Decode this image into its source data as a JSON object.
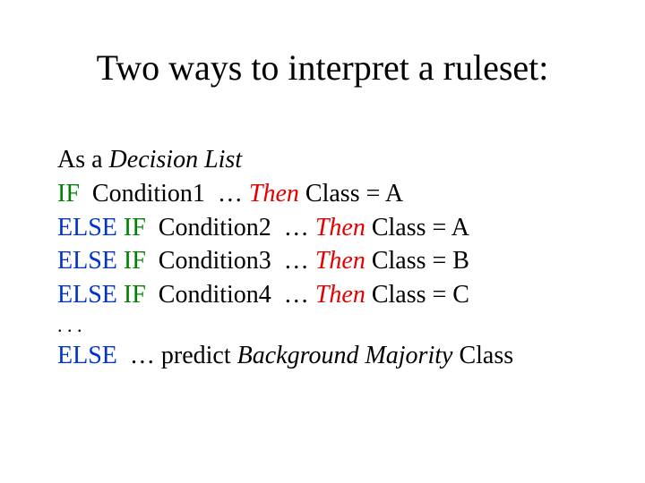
{
  "title": "Two ways to interpret a ruleset:",
  "lines": {
    "l1_as": "As a ",
    "l1_dl": "Decision List",
    "l2_if": "IF",
    "l2_cond": "  Condition1  … ",
    "l2_then": "Then",
    "l2_rest": " Class = A",
    "l3_else": "ELSE",
    "l3_if": " IF",
    "l3_cond": "  Condition2  … ",
    "l3_then": "Then",
    "l3_rest": " Class = A",
    "l4_else": "ELSE",
    "l4_if": " IF",
    "l4_cond": "  Condition3  … ",
    "l4_then": "Then",
    "l4_rest": " Class = B",
    "l5_else": "ELSE",
    "l5_if": " IF",
    "l5_cond": "  Condition4  … ",
    "l5_then": "Then",
    "l5_rest": " Class = C",
    "dots": ". . .",
    "l7_else": "ELSE",
    "l7_pred": "  … predict ",
    "l7_bg": "Background Majority",
    "l7_class": " Class"
  }
}
